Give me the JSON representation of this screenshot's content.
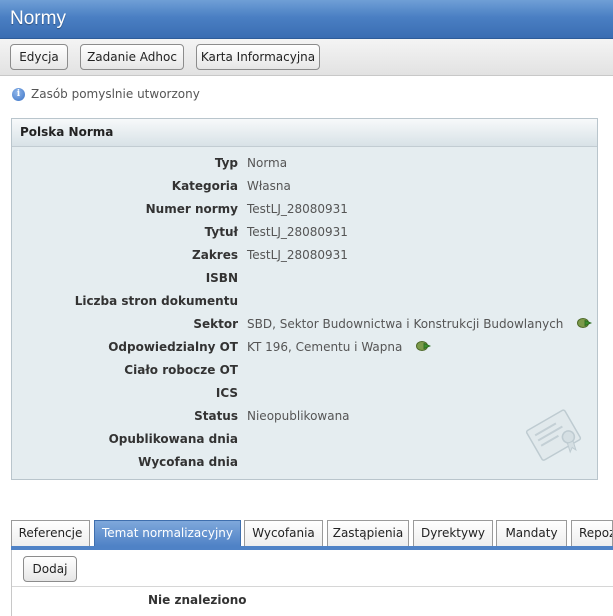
{
  "window": {
    "title": "Normy"
  },
  "toolbar": {
    "buttons": [
      {
        "label": "Edycja"
      },
      {
        "label": "Zadanie Adhoc"
      },
      {
        "label": "Karta Informacyjna"
      }
    ]
  },
  "status": {
    "message": "Zasób pomyslnie utworzony",
    "icon": "info-icon"
  },
  "panel": {
    "title": "Polska Norma",
    "fields": [
      {
        "label": "Typ",
        "value": "Norma"
      },
      {
        "label": "Kategoria",
        "value": "Własna"
      },
      {
        "label": "Numer normy",
        "value": "TestLJ_28080931"
      },
      {
        "label": "Tytuł",
        "value": "TestLJ_28080931"
      },
      {
        "label": "Zakres",
        "value": "TestLJ_28080931"
      },
      {
        "label": "ISBN",
        "value": ""
      },
      {
        "label": "Liczba stron dokumentu",
        "value": ""
      },
      {
        "label": "Sektor",
        "value": "SBD, Sektor Budownictwa i Konstrukcji Budowlanych"
      },
      {
        "label": "Odpowiedzialny OT",
        "value": "KT 196, Cementu i Wapna"
      },
      {
        "label": "Ciało robocze OT",
        "value": ""
      },
      {
        "label": "ICS",
        "value": ""
      },
      {
        "label": "Status",
        "value": "Nieopublikowana"
      },
      {
        "label": "Opublikowana dnia",
        "value": ""
      },
      {
        "label": "Wycofana dnia",
        "value": ""
      }
    ]
  },
  "tabs": [
    {
      "label": "Referencje",
      "active": false
    },
    {
      "label": "Temat normalizacyjny",
      "active": true
    },
    {
      "label": "Wycofania",
      "active": false
    },
    {
      "label": "Zastąpienia",
      "active": false
    },
    {
      "label": "Dyrektywy",
      "active": false
    },
    {
      "label": "Mandaty",
      "active": false
    },
    {
      "label": "Repozytoria",
      "active": false
    }
  ],
  "tab_content": {
    "add_label": "Dodaj",
    "empty_message": "Nie znaleziono"
  },
  "colors": {
    "titlebar": "#4a7fc3",
    "panel_bg": "#e5edf0",
    "active_tab": "#4f82c6"
  }
}
